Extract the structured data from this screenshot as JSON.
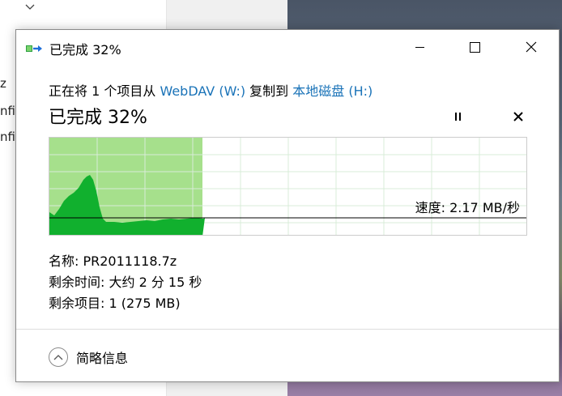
{
  "background": {
    "fragments": [
      "z",
      "nfi",
      "nfi"
    ]
  },
  "dialog": {
    "title": "已完成 32%",
    "description": {
      "prefix": "正在将 1 个项目从 ",
      "source": "WebDAV (W:)",
      "middle": " 复制到 ",
      "destination": "本地磁盘 (H:)"
    },
    "progress_heading": "已完成 32%",
    "progress_percent": 32,
    "speed_text": "速度: 2.17 MB/秒",
    "info": {
      "name": "名称:  PR2011118.7z",
      "time_remaining": "剩余时间:  大约 2 分 15 秒",
      "items_remaining": "剩余项目:  1 (275 MB)"
    },
    "details_label": "简略信息",
    "colors": {
      "progress_fill": "#a6e08c",
      "graph_area": "#11b02e",
      "link": "#1a73b8",
      "grid": "#d8ecd8"
    },
    "icons": {
      "title": "copy-progress-icon",
      "pause": "pause-icon",
      "stop": "close-icon",
      "details": "chevron-up-icon"
    }
  }
}
